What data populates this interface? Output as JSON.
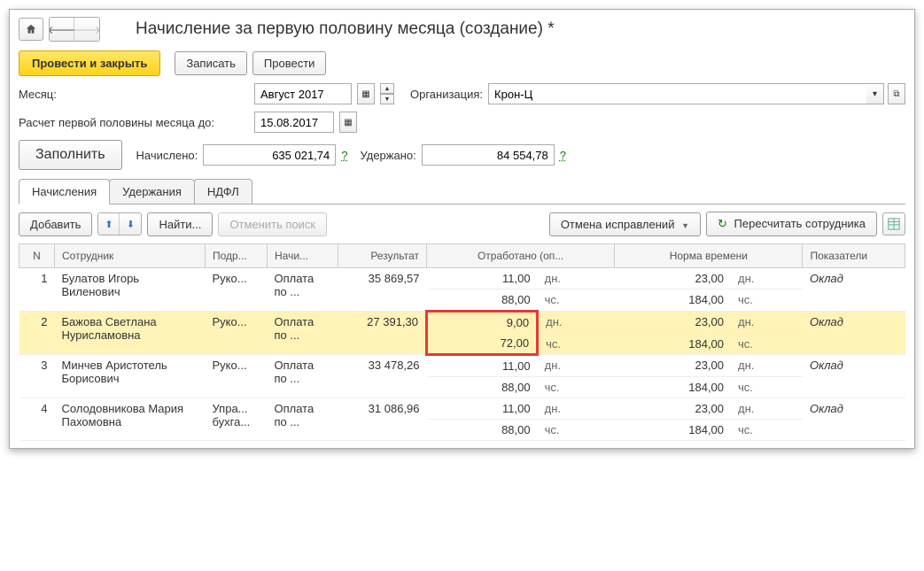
{
  "title": "Начисление за первую половину месяца (создание) *",
  "buttons": {
    "postAndClose": "Провести и закрыть",
    "save": "Записать",
    "post": "Провести",
    "fill": "Заполнить",
    "add": "Добавить",
    "find": "Найти...",
    "cancelSearch": "Отменить поиск",
    "cancelCorrections": "Отмена исправлений",
    "recalcEmployee": "Пересчитать сотрудника"
  },
  "labels": {
    "month": "Месяц:",
    "organization": "Организация:",
    "calcUntil": "Расчет первой половины месяца до:",
    "accrued": "Начислено:",
    "withheld": "Удержано:",
    "help": "?"
  },
  "fields": {
    "month": "Август 2017",
    "calcDate": "15.08.2017",
    "organization": "Крон-Ц",
    "accrued": "635 021,74",
    "withheld": "84 554,78"
  },
  "tabs": {
    "accruals": "Начисления",
    "withholdings": "Удержания",
    "ndfl": "НДФЛ"
  },
  "columns": {
    "n": "N",
    "employee": "Сотрудник",
    "dept": "Подр...",
    "accrual": "Начи...",
    "result": "Результат",
    "worked": "Отработано (оп...",
    "norm": "Норма времени",
    "indicators": "Показатели"
  },
  "units": {
    "days": "дн.",
    "hours": "чс."
  },
  "rows": [
    {
      "n": "1",
      "employee": "Булатов Игорь Виленович",
      "dept": "Руко...",
      "accrual": "Оплата по ...",
      "result": "35 869,57",
      "workedDays": "11,00",
      "workedHours": "88,00",
      "normDays": "23,00",
      "normHours": "184,00",
      "indicator": "Оклад",
      "selected": false,
      "highlight": false
    },
    {
      "n": "2",
      "employee": "Бажова Светлана Нурисламовна",
      "dept": "Руко...",
      "accrual": "Оплата по ...",
      "result": "27 391,30",
      "workedDays": "9,00",
      "workedHours": "72,00",
      "normDays": "23,00",
      "normHours": "184,00",
      "indicator": "Оклад",
      "selected": true,
      "highlight": true
    },
    {
      "n": "3",
      "employee": "Минчев Аристотель Борисович",
      "dept": "Руко...",
      "accrual": "Оплата по ...",
      "result": "33 478,26",
      "workedDays": "11,00",
      "workedHours": "88,00",
      "normDays": "23,00",
      "normHours": "184,00",
      "indicator": "Оклад",
      "selected": false,
      "highlight": false
    },
    {
      "n": "4",
      "employee": "Солодовникова Мария Пахомовна",
      "dept": "Упра... бухга...",
      "accrual": "Оплата по ...",
      "result": "31 086,96",
      "workedDays": "11,00",
      "workedHours": "88,00",
      "normDays": "23,00",
      "normHours": "184,00",
      "indicator": "Оклад",
      "selected": false,
      "highlight": false
    }
  ]
}
